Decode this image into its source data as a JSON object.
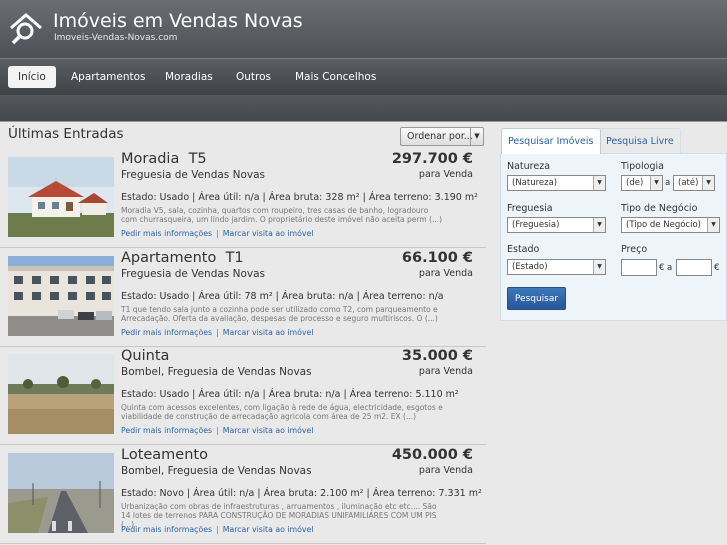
{
  "header": {
    "title": "Imóveis em Vendas Novas",
    "subtitle": "Imoveis-Vendas-Novas.com",
    "logo_icon": "house-search-icon"
  },
  "nav": {
    "items": [
      {
        "label": "Início",
        "active": true
      },
      {
        "label": "Apartamentos"
      },
      {
        "label": "Moradias"
      },
      {
        "label": "Outros"
      },
      {
        "label": "Mais Concelhos"
      }
    ]
  },
  "main": {
    "section_title": "Últimas Entradas",
    "sort_label": "Ordenar por...",
    "listings": [
      {
        "title": "Moradia  T5",
        "location": "Freguesia de Vendas Novas",
        "price": "297.700 €",
        "deal": "para Venda",
        "specs": "Estado: Usado  | Área útil: n/a  | Área bruta: 328 m²  | Área terreno: 3.190 m²",
        "description": "Moradia V5, sala, cozinha, quartos com roupeiro, tres casas de banho, logradouro com churrasqueira, um lindo jardim. O proprietário deste imóvel não aceita perm (...)",
        "link_info": "Pedir mais informações",
        "link_visit": "Marcar visita ao imóvel",
        "thumb": "house"
      },
      {
        "title": "Apartamento  T1",
        "location": "Freguesia de Vendas Novas",
        "price": "66.100 €",
        "deal": "para Venda",
        "specs": "Estado: Usado  | Área útil: 78 m²  | Área bruta: n/a  | Área terreno: n/a",
        "description": "T1 que tendo sala junto a cozinha pode ser utilizado como T2, com parqueamento e Arrecadação. Oferta da avaliação, despesas de processo e seguro multiriscos. O (...)",
        "link_info": "Pedir mais informações",
        "link_visit": "Marcar visita ao imóvel",
        "thumb": "building"
      },
      {
        "title": "Quinta",
        "location": "Bombel, Freguesia de Vendas Novas",
        "price": "35.000 €",
        "deal": "para Venda",
        "specs": "Estado: Usado  | Área útil: n/a  | Área bruta: n/a  | Área terreno: 5.110 m²",
        "description": "Quinta com acessos excelentes, com ligação à rede de água, electricidade, esgotos e viabilidade de construção de arrecadação agricola com área de 25 m2. EX (...)",
        "link_info": "Pedir mais informações",
        "link_visit": "Marcar visita ao imóvel",
        "thumb": "field"
      },
      {
        "title": "Loteamento",
        "location": "Bombel, Freguesia de Vendas Novas",
        "price": "450.000 €",
        "deal": "para Venda",
        "specs": "Estado: Novo  | Área útil: n/a  | Área bruta: 2.100 m²  | Área terreno: 7.331 m²",
        "description": "Urbanização com obras de infraestruturas , arruamentos , iluminação etc etc.... São 14 lotes de terrenos PARA CONSTRUÇÃO DE MORADIAS UNIFAMILIARES COM UM PIS (...)",
        "link_info": "Pedir mais informações",
        "link_visit": "Marcar visita ao imóvel",
        "thumb": "road"
      }
    ]
  },
  "search": {
    "tab_imoveis": "Pesquisar Imóveis",
    "tab_livre": "Pesquisa Livre",
    "natureza_label": "Natureza",
    "natureza_value": "(Natureza)",
    "tipologia_label": "Tipologia",
    "tipologia_from": "(de)",
    "tipologia_sep": "a",
    "tipologia_to": "(até)",
    "freguesia_label": "Freguesia",
    "freguesia_value": "(Freguesia)",
    "negocio_label": "Tipo de Negócio",
    "negocio_value": "(Tipo de Negócio)",
    "estado_label": "Estado",
    "estado_value": "(Estado)",
    "preco_label": "Preço",
    "preco_currency": "€",
    "preco_sep": "a",
    "preco_currency_2": "€",
    "button": "Pesquisar"
  }
}
